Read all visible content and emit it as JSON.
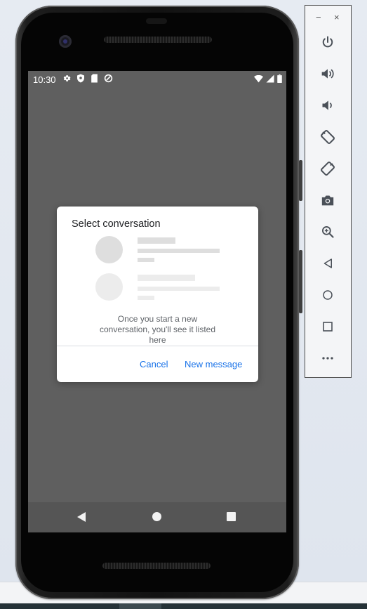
{
  "status_bar": {
    "time": "10:30",
    "left_icons": [
      "settings-icon",
      "shield-icon",
      "sd-card-icon",
      "data-saver-icon"
    ],
    "right_icons": [
      "wifi-icon",
      "signal-icon",
      "battery-icon"
    ]
  },
  "dialog": {
    "title": "Select conversation",
    "empty_message": "Once you start a new conversation, you'll see it listed here",
    "cancel_label": "Cancel",
    "new_message_label": "New message"
  },
  "navigation": {
    "buttons": [
      "back",
      "home",
      "recents"
    ]
  },
  "emulator_toolbar": {
    "window_controls": [
      "−",
      "×"
    ],
    "buttons": [
      "power",
      "volume-up",
      "volume-down",
      "rotate-left",
      "rotate-right",
      "screenshot",
      "zoom",
      "back",
      "home",
      "overview",
      "more"
    ]
  },
  "colors": {
    "accent": "#1a73e8",
    "scrim": "#5f5f5f",
    "placeholder_dark": "#dedede",
    "placeholder_light": "#ececec"
  }
}
